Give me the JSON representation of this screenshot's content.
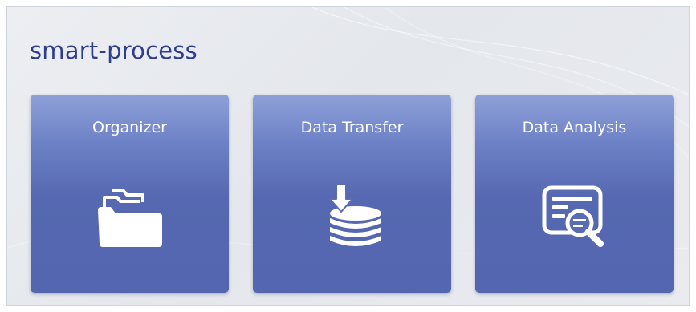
{
  "app": {
    "title": "smart-process"
  },
  "tiles": [
    {
      "label": "Organizer",
      "icon": "folders-icon"
    },
    {
      "label": "Data Transfer",
      "icon": "database-download-icon"
    },
    {
      "label": "Data Analysis",
      "icon": "document-search-icon"
    }
  ],
  "colors": {
    "title": "#2f3e8c",
    "tile_top": "#8ea1d8",
    "tile_bottom": "#5366af",
    "tile_text": "#ffffff",
    "panel_background": "#e6e9ee"
  }
}
